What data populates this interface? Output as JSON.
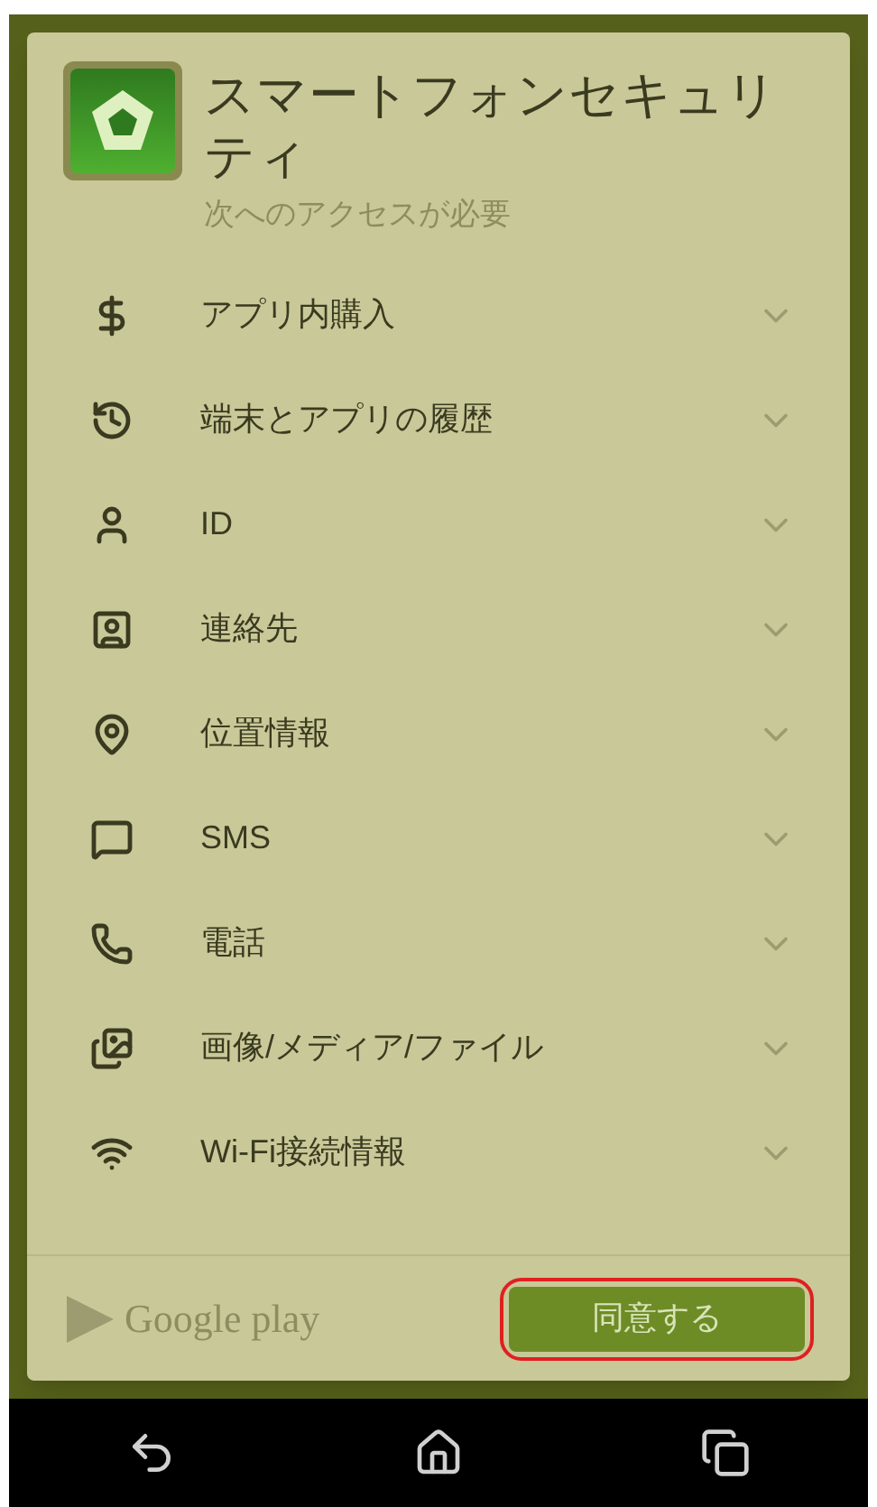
{
  "app": {
    "title": "スマートフォンセキュリティ",
    "subtitle": "次へのアクセスが必要"
  },
  "permissions": [
    {
      "label": "アプリ内購入"
    },
    {
      "label": "端末とアプリの履歴"
    },
    {
      "label": "ID"
    },
    {
      "label": "連絡先"
    },
    {
      "label": "位置情報"
    },
    {
      "label": "SMS"
    },
    {
      "label": "電話"
    },
    {
      "label": "画像/メディア/ファイル"
    },
    {
      "label": "Wi-Fi接続情報"
    }
  ],
  "footer": {
    "brand": "Google play",
    "accept_button": "同意する"
  }
}
